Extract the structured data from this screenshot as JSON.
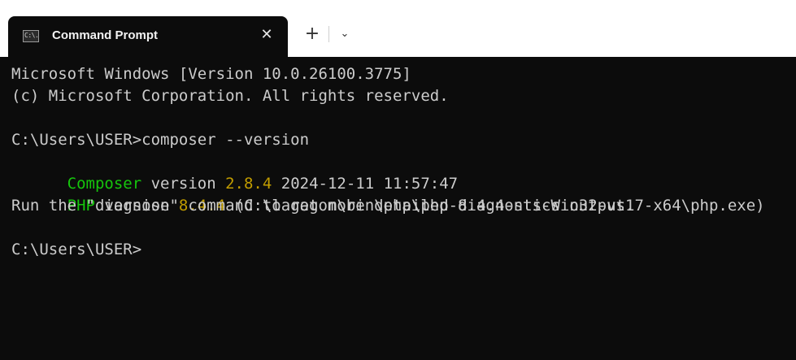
{
  "window": {
    "tab_title": "Command Prompt",
    "tab_icon_text": "C:\\.",
    "close_glyph": "✕",
    "new_tab_glyph": "+",
    "dropdown_glyph": "⌄"
  },
  "terminal": {
    "line1": "Microsoft Windows [Version 10.0.26100.3775]",
    "line2": "(c) Microsoft Corporation. All rights reserved.",
    "line3": "",
    "line4": "C:\\Users\\USER>composer --version",
    "line5": {
      "part1": "Composer",
      "part2": " version ",
      "part3": "2.8.4",
      "part4": " 2024-12-11 11:57:47"
    },
    "line6": {
      "part1": "PHP",
      "part2": " version ",
      "part3": "8.4.4",
      "part4": " (C:\\laragon\\bin\\php\\php-8.4.4-nts-Win32-vs17-x64\\php.exe)"
    },
    "line7": "Run the \"diagnose\" command to get more detailed diagnostics output.",
    "line8": "",
    "line9": "C:\\Users\\USER>"
  },
  "colors": {
    "background": "#0c0c0c",
    "text": "#cccccc",
    "green": "#16c60c",
    "yellow": "#c19c00"
  }
}
